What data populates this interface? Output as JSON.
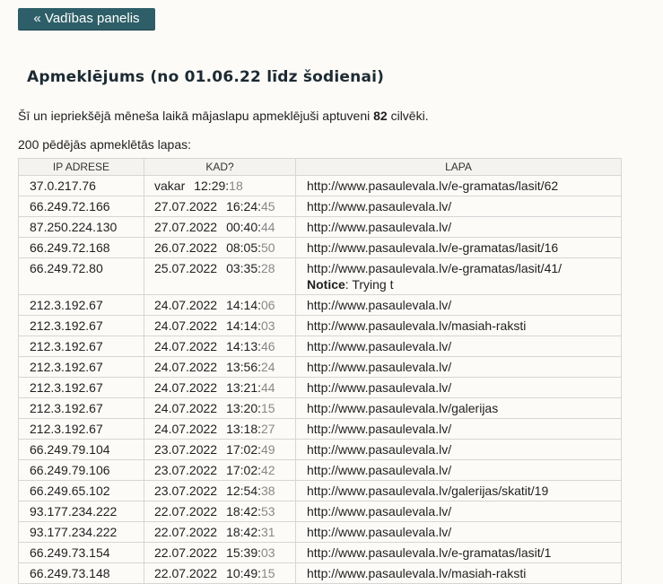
{
  "nav": {
    "back_label": "« Vadības panelis"
  },
  "heading": "Apmeklējums (no 01.06.22 līdz šodienai)",
  "summary": {
    "before": "Šī un iepriekšējā mēneša laikā mājaslapu apmeklējuši aptuveni ",
    "count": "82",
    "after": " cilvēki."
  },
  "table": {
    "caption": "200 pēdējās apmeklētās lapas:",
    "headers": [
      "IP ADRESE",
      "KAD?",
      "LAPA"
    ],
    "rows": [
      {
        "ip": "37.0.217.76",
        "date": "vakar",
        "time": "12:29:",
        "sec": "18",
        "page": "http://www.pasaulevala.lv/e-gramatas/lasit/62"
      },
      {
        "ip": "66.249.72.166",
        "date": "27.07.2022",
        "time": "16:24:",
        "sec": "45",
        "page": "http://www.pasaulevala.lv/"
      },
      {
        "ip": "87.250.224.130",
        "date": "27.07.2022",
        "time": "00:40:",
        "sec": "44",
        "page": "http://www.pasaulevala.lv/"
      },
      {
        "ip": "66.249.72.168",
        "date": "26.07.2022",
        "time": "08:05:",
        "sec": "50",
        "page": "http://www.pasaulevala.lv/e-gramatas/lasit/16"
      },
      {
        "ip": "66.249.72.80",
        "date": "25.07.2022",
        "time": "03:35:",
        "sec": "28",
        "page": "http://www.pasaulevala.lv/e-gramatas/lasit/41/",
        "notice_label": "Notice",
        "notice_text": ": Trying t"
      },
      {
        "ip": "212.3.192.67",
        "date": "24.07.2022",
        "time": "14:14:",
        "sec": "06",
        "page": "http://www.pasaulevala.lv/"
      },
      {
        "ip": "212.3.192.67",
        "date": "24.07.2022",
        "time": "14:14:",
        "sec": "03",
        "page": "http://www.pasaulevala.lv/masiah-raksti"
      },
      {
        "ip": "212.3.192.67",
        "date": "24.07.2022",
        "time": "14:13:",
        "sec": "46",
        "page": "http://www.pasaulevala.lv/"
      },
      {
        "ip": "212.3.192.67",
        "date": "24.07.2022",
        "time": "13:56:",
        "sec": "24",
        "page": "http://www.pasaulevala.lv/"
      },
      {
        "ip": "212.3.192.67",
        "date": "24.07.2022",
        "time": "13:21:",
        "sec": "44",
        "page": "http://www.pasaulevala.lv/"
      },
      {
        "ip": "212.3.192.67",
        "date": "24.07.2022",
        "time": "13:20:",
        "sec": "15",
        "page": "http://www.pasaulevala.lv/galerijas"
      },
      {
        "ip": "212.3.192.67",
        "date": "24.07.2022",
        "time": "13:18:",
        "sec": "27",
        "page": "http://www.pasaulevala.lv/"
      },
      {
        "ip": "66.249.79.104",
        "date": "23.07.2022",
        "time": "17:02:",
        "sec": "49",
        "page": "http://www.pasaulevala.lv/"
      },
      {
        "ip": "66.249.79.106",
        "date": "23.07.2022",
        "time": "17:02:",
        "sec": "42",
        "page": "http://www.pasaulevala.lv/"
      },
      {
        "ip": "66.249.65.102",
        "date": "23.07.2022",
        "time": "12:54:",
        "sec": "38",
        "page": "http://www.pasaulevala.lv/galerijas/skatit/19"
      },
      {
        "ip": "93.177.234.222",
        "date": "22.07.2022",
        "time": "18:42:",
        "sec": "53",
        "page": "http://www.pasaulevala.lv/"
      },
      {
        "ip": "93.177.234.222",
        "date": "22.07.2022",
        "time": "18:42:",
        "sec": "31",
        "page": "http://www.pasaulevala.lv/"
      },
      {
        "ip": "66.249.73.154",
        "date": "22.07.2022",
        "time": "15:39:",
        "sec": "03",
        "page": "http://www.pasaulevala.lv/e-gramatas/lasit/1"
      },
      {
        "ip": "66.249.73.148",
        "date": "22.07.2022",
        "time": "10:49:",
        "sec": "15",
        "page": "http://www.pasaulevala.lv/masiah-raksti"
      }
    ]
  }
}
